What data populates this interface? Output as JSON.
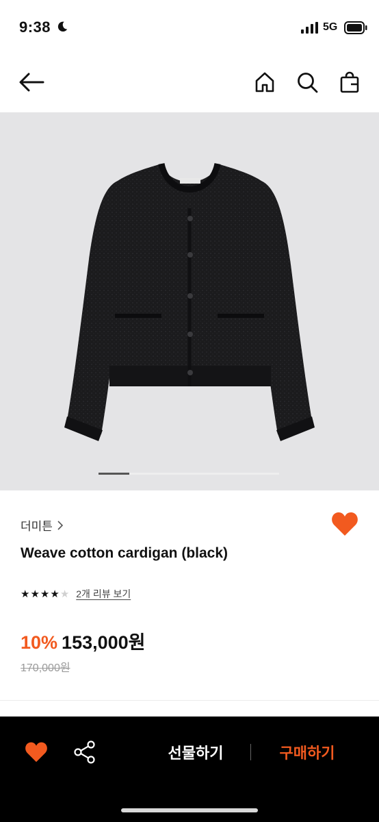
{
  "status_bar": {
    "time": "9:38",
    "network": "5G"
  },
  "nav": {
    "icons": [
      "back-arrow-icon",
      "home-icon",
      "search-icon",
      "shopping-bag-icon"
    ]
  },
  "product": {
    "image_alt": "black cardigan",
    "carousel_index": 1,
    "carousel_total": 6,
    "brand": "더미튼",
    "title": "Weave cotton cardigan (black)",
    "rating": 4,
    "rating_max": 5,
    "review_link": "2개 리뷰 보기",
    "discount": "10%",
    "price": "153,000원",
    "original_price": "170,000원",
    "liked": true
  },
  "action_bar": {
    "gift_label": "선물하기",
    "buy_label": "구매하기"
  },
  "colors": {
    "accent": "#f25a1f",
    "background": "#ffffff",
    "action_bar": "#000000"
  }
}
